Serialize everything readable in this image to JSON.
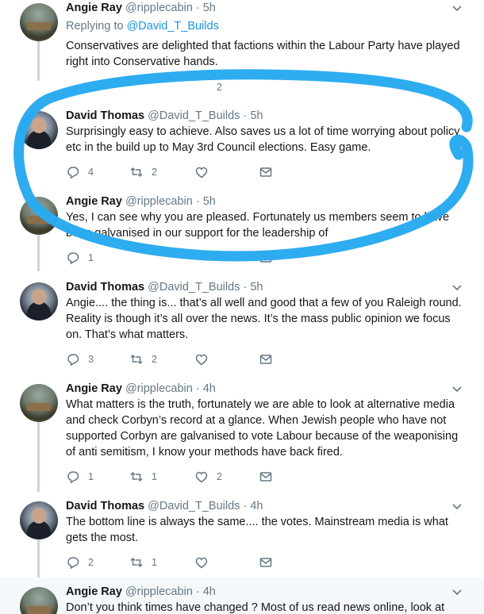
{
  "tweets": [
    {
      "author": "Angie Ray",
      "handle": "@ripplecabin",
      "time": "5h",
      "avatar": "angie",
      "replying_prefix": "Replying to ",
      "replying_to": "@David_T_Builds",
      "text": "Conservatives are delighted that factions within the Labour Party have played right into Conservative hands.",
      "replies": "",
      "retweets": "",
      "likes": "2"
    },
    {
      "author": "David Thomas",
      "handle": "@David_T_Builds",
      "time": "5h",
      "avatar": "david",
      "text": "Surprisingly easy to achieve. Also saves us a lot of time worrying about policy etc in the build up to May 3rd Council elections. Easy game.",
      "replies": "4",
      "retweets": "2",
      "likes": ""
    },
    {
      "author": "Angie Ray",
      "handle": "@ripplecabin",
      "time": "5h",
      "avatar": "angie",
      "text": "Yes, I can see why you are pleased. Fortunately us members seem to have been galvanised in our support for the leadership of",
      "replies": "1",
      "retweets": "",
      "likes": ""
    },
    {
      "author": "David Thomas",
      "handle": "@David_T_Builds",
      "time": "5h",
      "avatar": "david",
      "text": "Angie.... the thing is... that’s all well and good that a few of you Raleigh round. Reality is though it’s all over the news. It’s the mass public opinion we focus on. That’s what matters.",
      "replies": "3",
      "retweets": "2",
      "likes": ""
    },
    {
      "author": "Angie Ray",
      "handle": "@ripplecabin",
      "time": "4h",
      "avatar": "angie",
      "text": "What matters is the truth, fortunately we are able to look at alternative media and check Corbyn’s record at a glance. When Jewish people who have not supported Corbyn are galvanised to vote Labour because of the weaponising of anti semitism, I know your methods have back fired.",
      "replies": "1",
      "retweets": "1",
      "likes": "2"
    },
    {
      "author": "David Thomas",
      "handle": "@David_T_Builds",
      "time": "4h",
      "avatar": "david",
      "text": "The bottom line is always the same.... the votes. Mainstream media is what gets the most.",
      "replies": "2",
      "retweets": "1",
      "likes": ""
    },
    {
      "author": "Angie Ray",
      "handle": "@ripplecabin",
      "time": "4h",
      "avatar": "angie",
      "text": "Don’t you think times have changed ? Most of us read news online, look at",
      "replies": "",
      "retweets": "",
      "likes": ""
    }
  ],
  "separator": "·",
  "colors": {
    "accent": "#1b95e0",
    "annotation": "#2aaaf0",
    "muted": "#657786"
  }
}
